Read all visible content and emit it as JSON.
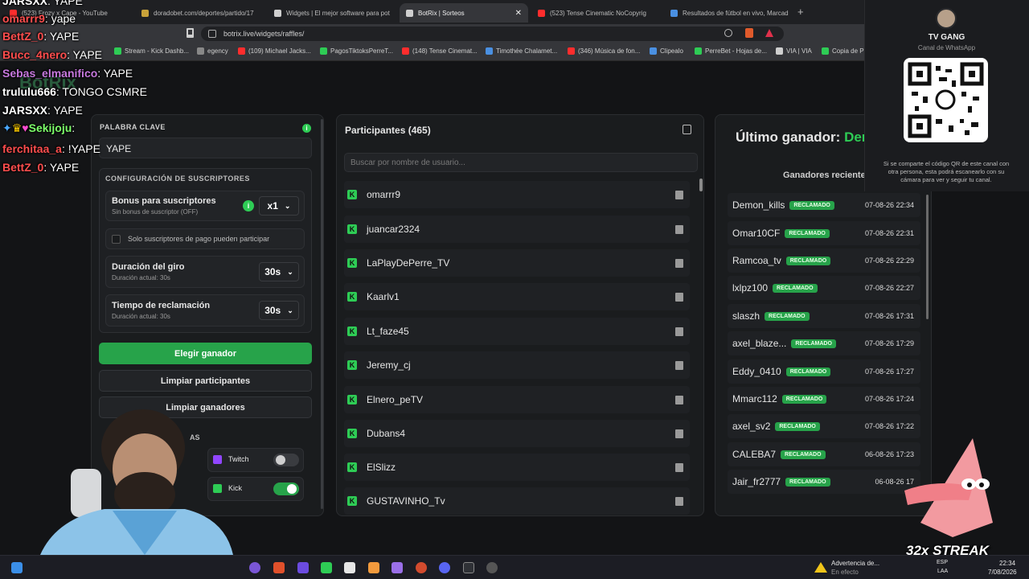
{
  "tabs": [
    {
      "label": "(523) Frozy x Cape - YouTube",
      "color": "#ff2d2d"
    },
    {
      "label": "doradobet.com/deportes/partido/17",
      "color": "#c8a23a"
    },
    {
      "label": "Widgets | El mejor software para pot",
      "color": "#cfcfcf"
    },
    {
      "label": "BotRix | Sorteos",
      "color": "#cfcfcf"
    },
    {
      "label": "(523) Tense Cinematic NoCopyrig",
      "color": "#ff2d2d"
    },
    {
      "label": "Resultados de fútbol en vivo, Marcad",
      "color": "#4a90e2"
    }
  ],
  "url": "botrix.live/widgets/raffles/",
  "bookmarks": [
    {
      "label": "Stream - Kick Dashb...",
      "color": "#2ecc55"
    },
    {
      "label": "egency",
      "color": "#888888"
    },
    {
      "label": "(109) Michael Jacks...",
      "color": "#ff2d2d"
    },
    {
      "label": "PagosTiktoksPerreT...",
      "color": "#2ecc55"
    },
    {
      "label": "(148) Tense Cinemat...",
      "color": "#ff2d2d"
    },
    {
      "label": "Timothée Chalamet...",
      "color": "#4a90e2"
    },
    {
      "label": "(346) Música de fon...",
      "color": "#ff2d2d"
    },
    {
      "label": "Clipealo",
      "color": "#4a90e2"
    },
    {
      "label": "PerreBet - Hojas de...",
      "color": "#2ecc55"
    },
    {
      "label": "VIA | VIA",
      "color": "#cfcfcf"
    },
    {
      "label": "Copia de P",
      "color": "#2ecc55"
    }
  ],
  "chat": [
    {
      "user": "JARSXX",
      "msg": ": YAPE",
      "color": "#ffffff"
    },
    {
      "user": "omarrr9",
      "msg": ": yape",
      "color": "#ff4d4d"
    },
    {
      "user": "BettZ_0",
      "msg": ": YAPE",
      "color": "#ff4d4d"
    },
    {
      "user": "Bucc_4nero",
      "msg": ": YAPE",
      "color": "#ff4d4d"
    },
    {
      "user": "Sebas_elmanifico",
      "msg": ": YAPE",
      "color": "#c678dd"
    },
    {
      "user": "trululu666",
      "msg": ": TONGO CSMRE",
      "color": "#ffffff"
    },
    {
      "user": "JARSXX",
      "msg": ": YAPE",
      "color": "#ffffff"
    },
    {
      "user": "Sekijoju",
      "msg": ":",
      "color": "#7dff6a"
    },
    {
      "user": "ferchitaa_a",
      "msg": ": !YAPE",
      "color": "#ff4d4d"
    },
    {
      "user": "BettZ_0",
      "msg": ": YAPE",
      "color": "#ff4d4d"
    }
  ],
  "watermark": "BotRix",
  "config": {
    "keyword_label": "PALABRA CLAVE",
    "keyword_value": "YAPE",
    "subs_title": "CONFIGURACIÓN DE SUSCRIPTORES",
    "bonus_label": "Bonus para suscriptores",
    "bonus_sub": "Sin bonus de suscriptor (OFF)",
    "bonus_value": "x1",
    "only_subs": "Solo suscriptores de pago pueden participar",
    "spin_label": "Duración del giro",
    "spin_sub": "Duración actual: 30s",
    "spin_value": "30s",
    "claim_label": "Tiempo de reclamación",
    "claim_sub": "Duración actual: 30s",
    "claim_value": "30s",
    "pick_winner": "Elegir ganador",
    "clear_participants": "Limpiar participantes",
    "clear_winners": "Limpiar ganadores",
    "platforms_label": "AS",
    "twitch": "Twitch",
    "kick": "Kick"
  },
  "participants": {
    "title": "Participantes (465)",
    "search_placeholder": "Buscar por nombre de usuario...",
    "list": [
      "omarrr9",
      "juancar2324",
      "LaPlayDePerre_TV",
      "Kaarlv1",
      "Lt_faze45",
      "Jeremy_cj",
      "Elnero_peTV",
      "Dubans4",
      "ElSlizz",
      "GUSTAVINHO_Tv"
    ]
  },
  "winners": {
    "last_label": "Último ganador:",
    "last_name": "Dem",
    "recent_title": "Ganadores reciente",
    "badge": "RECLAMADO",
    "list": [
      {
        "name": "Demon_kills",
        "date": "07-08-26 22:34"
      },
      {
        "name": "Omar10CF",
        "date": "07-08-26 22:31"
      },
      {
        "name": "Ramcoa_tv",
        "date": "07-08-26 22:29"
      },
      {
        "name": "lxlpz100",
        "date": "07-08-26 22:27"
      },
      {
        "name": "slaszh",
        "date": "07-08-26 17:31"
      },
      {
        "name": "axel_blaze...",
        "date": "07-08-26 17:29"
      },
      {
        "name": "Eddy_0410",
        "date": "07-08-26 17:27"
      },
      {
        "name": "Mmarc112",
        "date": "07-08-26 17:24"
      },
      {
        "name": "axel_sv2",
        "date": "07-08-26 17:22"
      },
      {
        "name": "CALEBA7",
        "date": "06-08-26 17:23"
      },
      {
        "name": "Jair_fr2777",
        "date": "06-08-26 17"
      }
    ]
  },
  "whatsapp": {
    "title": "TV GANG",
    "subtitle": "Canal de WhatsApp",
    "note": "Si se comparte el código QR de este canal con otra persona, esta podrá escanearlo con su cámara para ver y seguir tu canal."
  },
  "streak": "32x STREAK",
  "taskbar": {
    "warning_title": "Advertencia de...",
    "warning_sub": "En efecto",
    "lang": "ESP",
    "lang_sub": "LAA",
    "time": "22:34",
    "date": "7/08/2026"
  }
}
